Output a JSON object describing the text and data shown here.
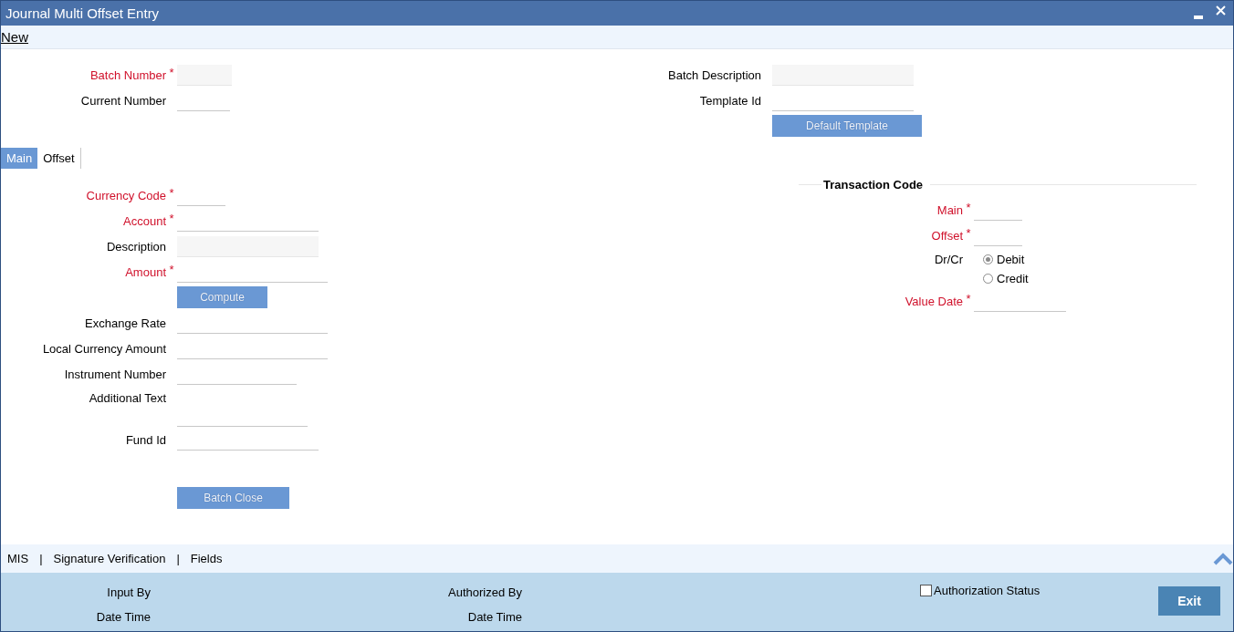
{
  "window": {
    "title": "Journal Multi Offset Entry"
  },
  "toolbar": {
    "actions": [
      {
        "label": "New"
      }
    ]
  },
  "header": {
    "left_fields": [
      {
        "kind": "field",
        "label": "Batch Number",
        "required": true,
        "mark": "*",
        "readonly": true
      },
      {
        "kind": "field",
        "label": "Current Number",
        "required": false,
        "readonly": false
      }
    ],
    "right_fields": [
      {
        "kind": "field",
        "label": "Batch Description",
        "required": false,
        "readonly": true
      },
      {
        "kind": "field",
        "label": "Template Id",
        "required": false,
        "readonly": false
      },
      {
        "kind": "button",
        "label": "Default Template"
      }
    ]
  },
  "tabs": [
    {
      "label": "Main",
      "selected": true
    },
    {
      "label": "Offset",
      "selected": false
    }
  ],
  "main_tab": {
    "left_fields": [
      {
        "kind": "field",
        "label": "Currency Code",
        "required": true,
        "mark": "*",
        "readonly": false
      },
      {
        "kind": "field",
        "label": "Account",
        "required": true,
        "mark": "*",
        "readonly": false
      },
      {
        "kind": "field",
        "label": "Description",
        "required": false,
        "readonly": true
      },
      {
        "kind": "field",
        "label": "Amount",
        "required": true,
        "mark": "*",
        "readonly": false
      },
      {
        "kind": "button",
        "label": "Compute"
      },
      {
        "kind": "field",
        "label": "Exchange Rate",
        "required": false,
        "readonly": false
      },
      {
        "kind": "field",
        "label": "Local Currency Amount",
        "required": false,
        "readonly": false
      },
      {
        "kind": "field",
        "label": "Instrument Number",
        "required": false,
        "readonly": false
      },
      {
        "kind": "textarea",
        "label": "Additional Text",
        "required": false,
        "readonly": false
      },
      {
        "kind": "field",
        "label": "Fund Id",
        "required": false,
        "readonly": false
      },
      {
        "kind": "wide_button",
        "label": "Batch Close"
      }
    ],
    "transaction_code": {
      "title": "Transaction Code",
      "fields": [
        {
          "kind": "field",
          "label": "Main",
          "required": true,
          "mark": "*",
          "readonly": false
        },
        {
          "kind": "field",
          "label": "Offset",
          "required": true,
          "mark": "*",
          "readonly": false
        },
        {
          "kind": "radio",
          "label": "Dr/Cr",
          "options": [
            {
              "label": "Debit",
              "selected": true
            },
            {
              "label": "Credit",
              "selected": false
            }
          ]
        },
        {
          "kind": "field",
          "label": "Value Date",
          "required": true,
          "mark": "*",
          "readonly": false
        }
      ]
    }
  },
  "bottom_tabs": [
    {
      "kind": "link",
      "label": "MIS"
    },
    {
      "kind": "separator",
      "label": "|"
    },
    {
      "kind": "link",
      "label": "Signature Verification"
    },
    {
      "kind": "separator",
      "label": "|"
    },
    {
      "kind": "link",
      "label": "Fields"
    }
  ],
  "footer": {
    "left": [
      {
        "label": "Input By"
      },
      {
        "label": "Date Time"
      }
    ],
    "middle": [
      {
        "label": "Authorized By"
      },
      {
        "label": "Date Time"
      }
    ],
    "authorization": {
      "label": "Authorization Status",
      "checked": false
    },
    "exit": "Exit"
  }
}
